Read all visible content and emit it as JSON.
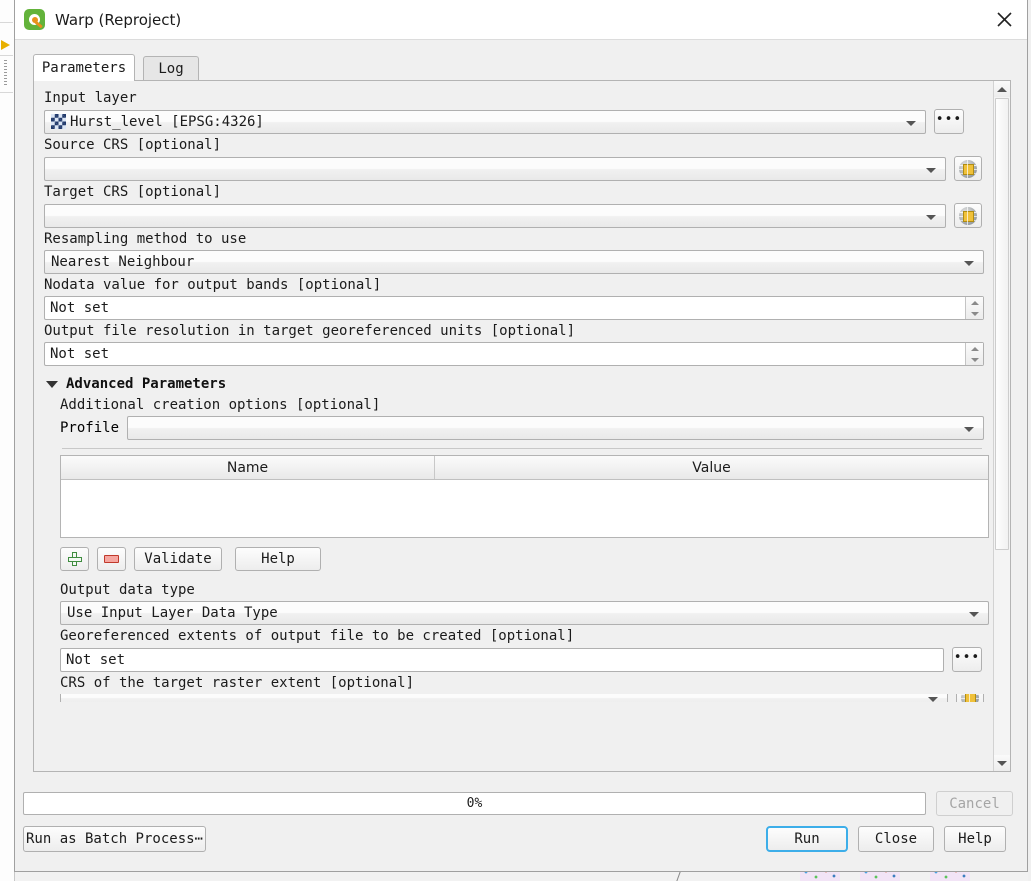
{
  "window": {
    "title": "Warp (Reproject)",
    "logo_icon": "qgis-logo-icon",
    "close_icon": "close-icon"
  },
  "tabs": [
    {
      "label": "Parameters",
      "selected": true
    },
    {
      "label": "Log",
      "selected": false
    }
  ],
  "parameters": {
    "input_layer": {
      "label": "Input layer",
      "value": "Hurst_level [EPSG:4326]",
      "layer_icon": "raster-layer-icon",
      "browse_label": "•••"
    },
    "source_crs": {
      "label": "Source CRS [optional]",
      "value": "",
      "crs_button_icon": "crs-globe-edit-icon"
    },
    "target_crs": {
      "label": "Target CRS [optional]",
      "value": "",
      "crs_button_icon": "crs-globe-edit-icon"
    },
    "resampling_method": {
      "label": "Resampling method to use",
      "value": "Nearest Neighbour"
    },
    "nodata_value": {
      "label": "Nodata value for output bands [optional]",
      "value": "Not set"
    },
    "output_resolution": {
      "label": "Output file resolution in target georeferenced units [optional]",
      "value": "Not set"
    }
  },
  "advanced": {
    "header": "Advanced Parameters",
    "expanded": true,
    "creation_options": {
      "label": "Additional creation options [optional]",
      "profile_label": "Profile",
      "profile_value": "",
      "table": {
        "columns": [
          "Name",
          "Value"
        ],
        "rows": []
      },
      "buttons": {
        "add_icon": "plus-icon",
        "remove_icon": "minus-icon",
        "validate": "Validate",
        "help": "Help"
      }
    },
    "output_data_type": {
      "label": "Output data type",
      "value": "Use Input Layer Data Type"
    },
    "georeferenced_extents": {
      "label": "Georeferenced extents of output file to be created [optional]",
      "value": "Not set",
      "browse_label": "•••"
    },
    "target_extent_crs": {
      "label": "CRS of the target raster extent [optional]",
      "value": ""
    }
  },
  "footer": {
    "progress": {
      "text": "0%",
      "percent": 0
    },
    "cancel": "Cancel",
    "batch": "Run as Batch Process⋯",
    "run": "Run",
    "close": "Close",
    "help": "Help"
  },
  "colors": {
    "accent": "#3daee9",
    "dialog_bg": "#f0f0f0",
    "qgis_green": "#63b33b",
    "qgis_orange": "#e8911a",
    "add_green": "#3f8c3f",
    "remove_red": "#c0392b"
  }
}
